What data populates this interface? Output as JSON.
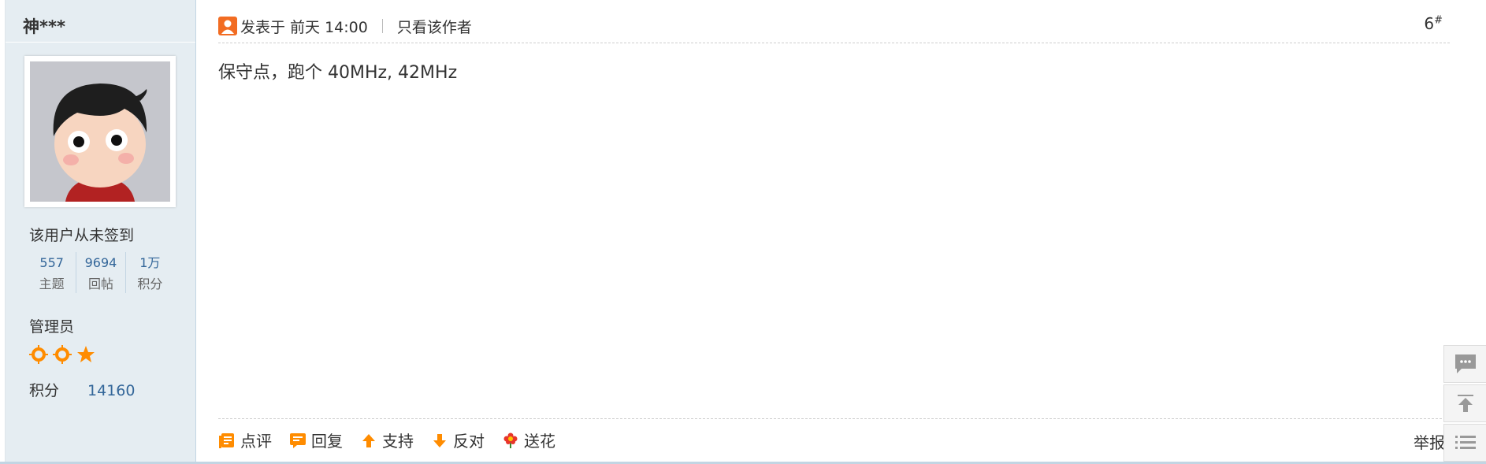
{
  "author": {
    "name": "神***",
    "signin": "该用户从未签到",
    "stats": [
      {
        "value": "557",
        "label": "主题"
      },
      {
        "value": "9694",
        "label": "回帖"
      },
      {
        "value": "1万",
        "label": "积分"
      }
    ],
    "role": "管理员",
    "points_label": "积分",
    "points_value": "14160"
  },
  "post": {
    "posted_at": "发表于 前天 14:00",
    "only_author": "只看该作者",
    "floor": "6",
    "floor_mark": "#",
    "content": "保守点，跑个 40MHz, 42MHz"
  },
  "actions": [
    {
      "name": "comment",
      "label": "点评",
      "icon": "comment-icon"
    },
    {
      "name": "reply",
      "label": "回复",
      "icon": "reply-icon"
    },
    {
      "name": "support",
      "label": "支持",
      "icon": "thumb-up-arrow-icon"
    },
    {
      "name": "oppose",
      "label": "反对",
      "icon": "thumb-down-arrow-icon"
    },
    {
      "name": "flower",
      "label": "送花",
      "icon": "flower-icon"
    }
  ],
  "report": "举报",
  "floatbar": [
    "chat-icon",
    "back-to-top-icon",
    "list-icon"
  ],
  "colors": {
    "accent": "#ff8c00",
    "link": "#336699",
    "sidebar": "#e5edf2"
  }
}
